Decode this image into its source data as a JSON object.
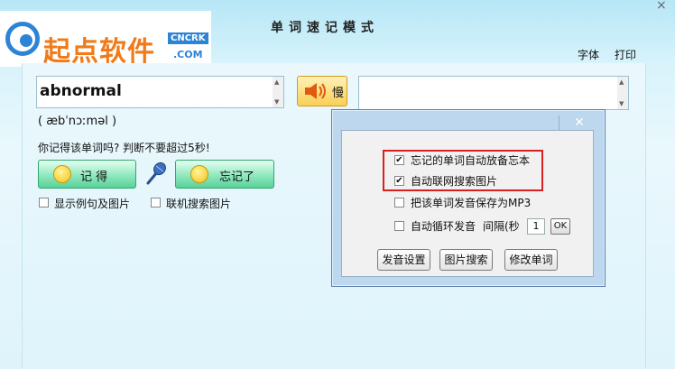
{
  "logo": {
    "text": "起点软件",
    "badge": "CNCRK",
    "domain": ".COM"
  },
  "window": {
    "title": "单词速记模式",
    "close_glyph": "×"
  },
  "menu": {
    "font": "字体",
    "print": "打印"
  },
  "word": {
    "value": "abnormal",
    "phonetic": "( æbˈnɔːməl )"
  },
  "speak_button": {
    "label": "慢"
  },
  "prompt": "你记得该单词吗? 判断不要超过5秒!",
  "buttons": {
    "remember": "记  得",
    "forgot": "忘记了"
  },
  "options": {
    "show_examples": {
      "label": "显示例句及图片",
      "checked": false
    },
    "online_images": {
      "label": "联机搜索图片",
      "checked": false
    }
  },
  "dialog": {
    "close_glyph": "✕",
    "checkboxes": [
      {
        "label": "忘记的单词自动放备忘本",
        "checked": true
      },
      {
        "label": "自动联网搜索图片",
        "checked": true
      },
      {
        "label": "把该单词发音保存为MP3",
        "checked": false
      },
      {
        "label": "自动循环发音",
        "checked": false
      }
    ],
    "interval_label": "间隔(秒",
    "interval_value": "1",
    "ok_label": "OK",
    "buttons": [
      "发音设置",
      "图片搜索",
      "修改单词"
    ]
  },
  "colors": {
    "highlight": "#d82020",
    "logo_orange": "#f07b1a",
    "logo_blue": "#2d84d6"
  }
}
